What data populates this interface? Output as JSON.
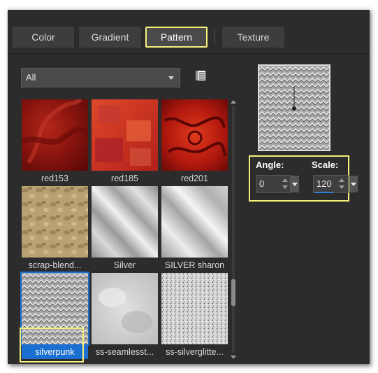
{
  "tabs": [
    {
      "label": "Color"
    },
    {
      "label": "Gradient"
    },
    {
      "label": "Pattern"
    },
    {
      "label": "Texture"
    }
  ],
  "filter": {
    "selected": "All"
  },
  "patterns": [
    {
      "name": "red153"
    },
    {
      "name": "red185"
    },
    {
      "name": "red201"
    },
    {
      "name": "scrap-blend..."
    },
    {
      "name": "Silver"
    },
    {
      "name": "SILVER sharon"
    },
    {
      "name": "silverpunk",
      "selected": true
    },
    {
      "name": "ss-seamlesst..."
    },
    {
      "name": "ss-silverglitte..."
    }
  ],
  "params": {
    "angle": {
      "label": "Angle:",
      "value": "0"
    },
    "scale": {
      "label": "Scale:",
      "value": "120"
    }
  },
  "colors": {
    "highlight": "#f4f07a",
    "selection": "#1b6fd0"
  }
}
